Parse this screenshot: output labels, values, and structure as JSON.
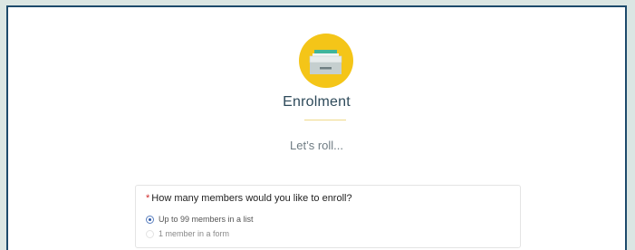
{
  "page": {
    "title": "Enrolment",
    "subtitle": "Let’s roll..."
  },
  "logo": {
    "icon": "inbox-tray-icon",
    "color": "#f4c518"
  },
  "form": {
    "required_marker": "*",
    "question": "How many members would you like to enroll?",
    "options": [
      {
        "label": "Up to 99 members in a list",
        "selected": true
      },
      {
        "label": "1 member in a form",
        "selected": false
      }
    ]
  },
  "colors": {
    "frame_border": "#1d4a6b",
    "page_background": "#dbe6e3",
    "accent_yellow": "#f4c518",
    "required_red": "#d02b2b"
  }
}
